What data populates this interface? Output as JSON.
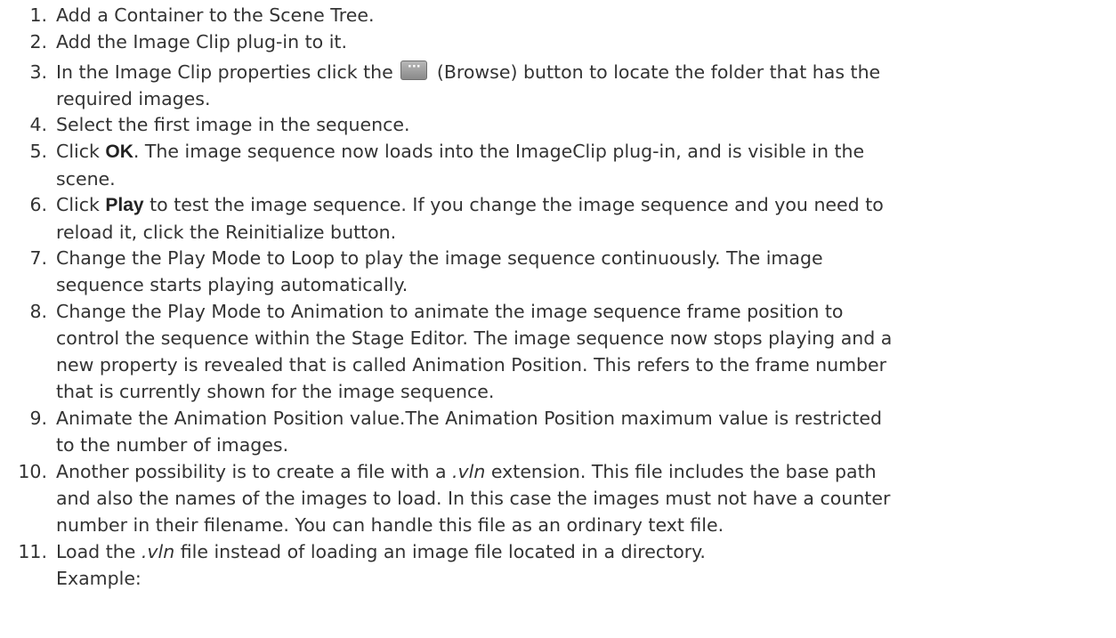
{
  "steps": [
    {
      "num": "1.",
      "lines": [
        "Add a Container to the Scene Tree."
      ]
    },
    {
      "num": "2.",
      "lines": [
        "Add the Image Clip plug-in to it."
      ]
    },
    {
      "num": "3.",
      "pre": "In the Image Clip properties click the",
      "post": "(Browse) button to locate the folder that has the",
      "line2": "required images."
    },
    {
      "num": "4.",
      "lines": [
        "Select the first image in the sequence."
      ]
    },
    {
      "num": "5.",
      "pre": "Click ",
      "bold": "OK",
      "post": ". The image sequence now loads into the ImageClip plug-in, and is visible in the",
      "line2": "scene."
    },
    {
      "num": "6.",
      "pre": "Click ",
      "bold": "Play",
      "post": " to test the image sequence. If you change the image sequence and you need to",
      "line2": "reload it, click the Reinitialize button."
    },
    {
      "num": "7.",
      "lines": [
        "Change the Play Mode to Loop to play the image sequence continuously. The image",
        "sequence starts playing automatically."
      ]
    },
    {
      "num": "8.",
      "lines": [
        "Change the Play Mode to Animation to animate the image sequence frame position to",
        "control the sequence within the Stage Editor. The image sequence now stops playing and a",
        "new property is revealed that is called Animation Position. This refers to the frame number",
        "that is currently shown for the image sequence."
      ]
    },
    {
      "num": "9.",
      "lines": [
        "Animate the Animation Position value.The Animation Position maximum value is restricted",
        "to the number of images."
      ]
    },
    {
      "num": "10.",
      "pre": "Another possibility is to create a file with a ",
      "italic": ".vln",
      "post": " extension. This file includes the base path",
      "line2": "and also the names of the images to load. In this case the images must not have a counter",
      "line3": "number in their filename. You can handle this file as an ordinary text file."
    },
    {
      "num": "11.",
      "pre": "Load the ",
      "italic": ".vln",
      "post": " file instead of loading an image file located in a directory.",
      "line2": "Example:"
    }
  ],
  "browse_button": {
    "label": "···",
    "icon": "ellipsis-icon"
  }
}
